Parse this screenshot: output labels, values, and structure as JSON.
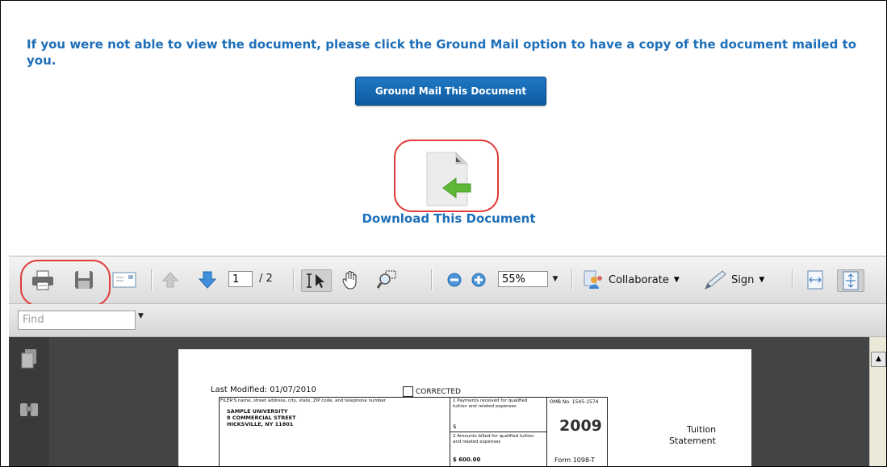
{
  "notice": {
    "text": "If you were not able to view the document, please click the Ground Mail option to have a copy of the document mailed to you."
  },
  "ground_mail_button": "Ground Mail This Document",
  "download": {
    "label": "Download This Document"
  },
  "toolbar": {
    "page_current": "1",
    "page_total": "/ 2",
    "zoom": "55%",
    "collaborate": "Collaborate",
    "sign": "Sign"
  },
  "find": {
    "placeholder": "Find"
  },
  "document": {
    "last_modified": "Last Modified: 01/07/2010",
    "corrected": "CORRECTED",
    "filer_header": "FILER'S name, street address, city, state, ZIP code, and telephone number",
    "filer_name": "SAMPLE UNIVERSITY",
    "filer_street": "8 COMMERCIAL STREET",
    "filer_city": "HICKSVILLE, NY 11801",
    "box1_label": "1  Payments received for qualified tuition and related expenses",
    "box1_value": "$",
    "box2_label": "2  Amounts billed for qualified tuition and related expenses",
    "box2_value": "$ 600.00",
    "omb": "OMB No. 1545-1574",
    "year": "2009",
    "form": "Form 1098-T",
    "title_line1": "Tuition",
    "title_line2": "Statement"
  }
}
